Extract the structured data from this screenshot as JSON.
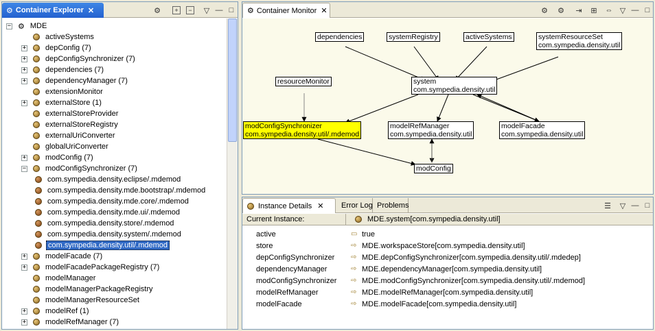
{
  "explorer": {
    "tab_label": "Container Explorer",
    "root": "MDE",
    "items": [
      {
        "label": "activeSystems",
        "expander": "none",
        "depth": 1
      },
      {
        "label": "depConfig (7)",
        "expander": "+",
        "depth": 1
      },
      {
        "label": "depConfigSynchronizer (7)",
        "expander": "+",
        "depth": 1
      },
      {
        "label": "dependencies (7)",
        "expander": "+",
        "depth": 1
      },
      {
        "label": "dependencyManager (7)",
        "expander": "+",
        "depth": 1
      },
      {
        "label": "extensionMonitor",
        "expander": "none",
        "depth": 1
      },
      {
        "label": "externalStore (1)",
        "expander": "+",
        "depth": 1
      },
      {
        "label": "externalStoreProvider",
        "expander": "none",
        "depth": 1
      },
      {
        "label": "externalStoreRegistry",
        "expander": "none",
        "depth": 1
      },
      {
        "label": "externalUriConverter",
        "expander": "none",
        "depth": 1
      },
      {
        "label": "globalUriConverter",
        "expander": "none",
        "depth": 1
      },
      {
        "label": "modConfig (7)",
        "expander": "+",
        "depth": 1
      },
      {
        "label": "modConfigSynchronizer (7)",
        "expander": "-",
        "depth": 1
      },
      {
        "label": "com.sympedia.density.eclipse/.mdemod",
        "expander": "none",
        "depth": 2
      },
      {
        "label": "com.sympedia.density.mde.bootstrap/.mdemod",
        "expander": "none",
        "depth": 2
      },
      {
        "label": "com.sympedia.density.mde.core/.mdemod",
        "expander": "none",
        "depth": 2
      },
      {
        "label": "com.sympedia.density.mde.ui/.mdemod",
        "expander": "none",
        "depth": 2
      },
      {
        "label": "com.sympedia.density.store/.mdemod",
        "expander": "none",
        "depth": 2
      },
      {
        "label": "com.sympedia.density.system/.mdemod",
        "expander": "none",
        "depth": 2
      },
      {
        "label": "com.sympedia.density.util/.mdemod",
        "expander": "none",
        "depth": 2,
        "selected": true
      },
      {
        "label": "modelFacade (7)",
        "expander": "+",
        "depth": 1
      },
      {
        "label": "modelFacadePackageRegistry (7)",
        "expander": "+",
        "depth": 1
      },
      {
        "label": "modelManager",
        "expander": "none",
        "depth": 1
      },
      {
        "label": "modelManagerPackageRegistry",
        "expander": "none",
        "depth": 1
      },
      {
        "label": "modelManagerResourceSet",
        "expander": "none",
        "depth": 1
      },
      {
        "label": "modelRef (1)",
        "expander": "+",
        "depth": 1
      },
      {
        "label": "modelRefManager (7)",
        "expander": "+",
        "depth": 1
      }
    ]
  },
  "monitor": {
    "tab_label": "Container Monitor",
    "nodes": {
      "dependencies": {
        "line1": "dependencies",
        "line2": ""
      },
      "systemRegistry": {
        "line1": "systemRegistry",
        "line2": ""
      },
      "activeSystems": {
        "line1": "activeSystems",
        "line2": ""
      },
      "systemResourceSet": {
        "line1": "systemResourceSet",
        "line2": "com.sympedia.density.util"
      },
      "resourceMonitor": {
        "line1": "resourceMonitor",
        "line2": ""
      },
      "system": {
        "line1": "system",
        "line2": "com.sympedia.density.util"
      },
      "modConfigSynchronizer": {
        "line1": "modConfigSynchronizer",
        "line2": "com.sympedia.density.util/.mdemod"
      },
      "modelRefManager": {
        "line1": "modelRefManager",
        "line2": "com.sympedia.density.util"
      },
      "modelFacade": {
        "line1": "modelFacade",
        "line2": "com.sympedia.density.util"
      },
      "modConfig": {
        "line1": "modConfig",
        "line2": ""
      }
    }
  },
  "details": {
    "tabs": [
      "Instance Details",
      "Error Log",
      "Problems"
    ],
    "current_label": "Current Instance:",
    "current_value": "MDE.system[com.sympedia.density.util]",
    "rows": [
      {
        "name": "active",
        "value": "true"
      },
      {
        "name": "store",
        "value": "MDE.workspaceStore[com.sympedia.density.util]"
      },
      {
        "name": "depConfigSynchronizer",
        "value": "MDE.depConfigSynchronizer[com.sympedia.density.util/.mdedep]"
      },
      {
        "name": "dependencyManager",
        "value": "MDE.dependencyManager[com.sympedia.density.util]"
      },
      {
        "name": "modConfigSynchronizer",
        "value": "MDE.modConfigSynchronizer[com.sympedia.density.util/.mdemod]"
      },
      {
        "name": "modelRefManager",
        "value": "MDE.modelRefManager[com.sympedia.density.util]"
      },
      {
        "name": "modelFacade",
        "value": "MDE.modelFacade[com.sympedia.density.util]"
      }
    ]
  },
  "colors": {
    "accent": "#316ac5",
    "highlight": "#ffff00",
    "canvas": "#fbfaea"
  }
}
